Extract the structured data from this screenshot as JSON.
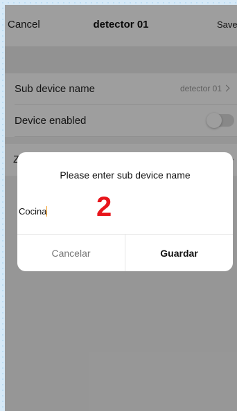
{
  "header": {
    "cancel_label": "Cancel",
    "title": "detector 01",
    "save_label": "Save"
  },
  "settings": {
    "rows": [
      {
        "label": "Sub device name",
        "value": "detector 01"
      },
      {
        "label": "Device enabled",
        "toggle_on": false
      },
      {
        "label": "Z"
      }
    ]
  },
  "dialog": {
    "title": "Please enter sub device name",
    "input_value": "Cocina",
    "cancel_label": "Cancelar",
    "save_label": "Guardar"
  },
  "annotation": {
    "step_number": "2",
    "color": "#e8141b"
  },
  "colors": {
    "caret": "#f29a1f",
    "backdrop": "#d6e9f7"
  },
  "icons": [
    "chevron-right-icon",
    "toggle-switch"
  ]
}
